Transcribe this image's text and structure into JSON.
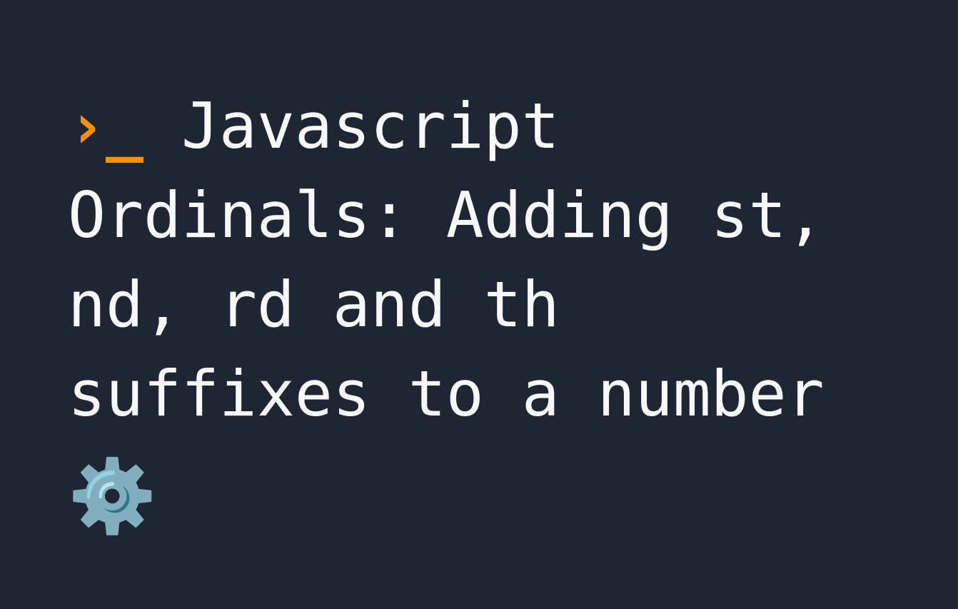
{
  "prompt": {
    "caret": "›",
    "underscore": "_"
  },
  "title": " Javascript Ordinals: Adding st, nd, rd and th suffixes to a number",
  "gear_emoji": "⚙️"
}
